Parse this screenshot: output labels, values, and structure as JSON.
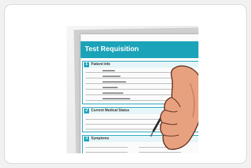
{
  "form": {
    "title": "Test Requisition",
    "sections": [
      {
        "number": "1",
        "title": "Patient Info"
      },
      {
        "number": "2",
        "title": "Current Medical Status"
      },
      {
        "number": "3",
        "title": "Symptoms"
      }
    ]
  },
  "colors": {
    "accent": "#1aa3b9",
    "skin": "#e8a17f",
    "pen": "#2a2a2a"
  },
  "icons": {
    "hand": "hand-with-pen-icon"
  }
}
